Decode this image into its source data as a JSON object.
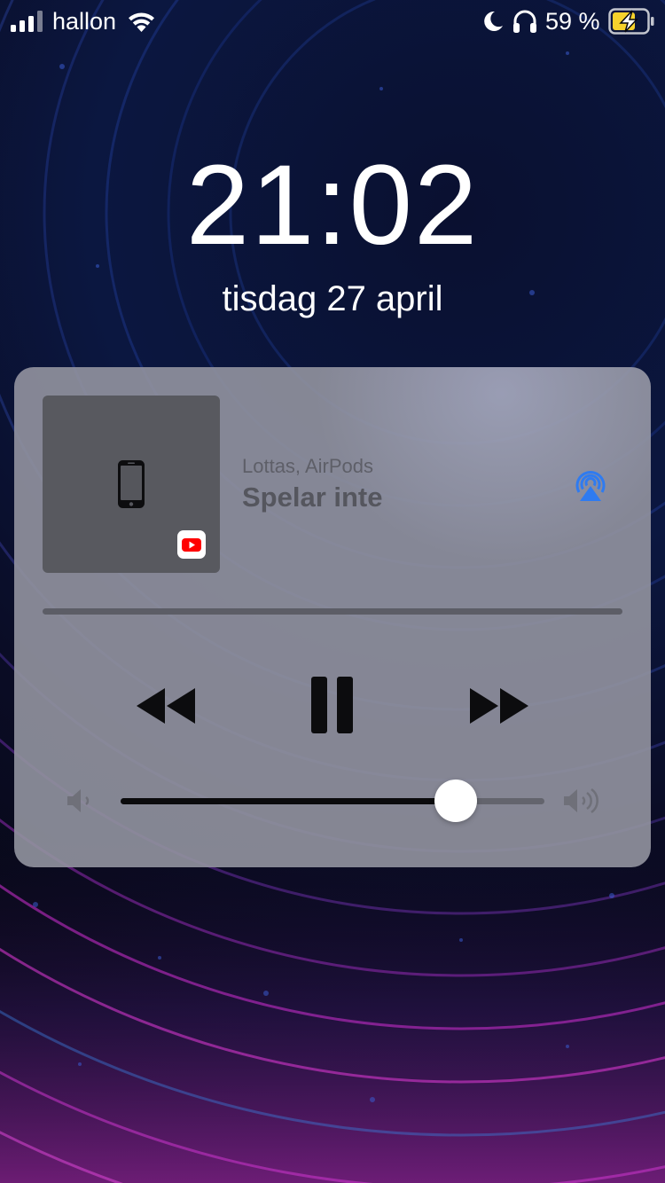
{
  "status_bar": {
    "carrier": "hallon",
    "battery_percent": "59 %",
    "icons": [
      "signal-icon",
      "wifi-icon",
      "moon-icon",
      "headphones-icon",
      "battery-charging-icon"
    ]
  },
  "lock_screen": {
    "time": "21:02",
    "date": "tisdag 27 april"
  },
  "now_playing": {
    "device_label": "Lottas, AirPods",
    "title": "Spelar inte",
    "progress": 0,
    "volume": 0.79,
    "icons": [
      "phone-icon",
      "youtube-icon",
      "airplay-icon",
      "rewind-icon",
      "pause-icon",
      "fast-forward-icon",
      "volume-low-icon",
      "volume-high-icon"
    ]
  },
  "colors": {
    "airplay": "#2f7bf0",
    "youtube": "#ff0000",
    "battery_charge": "#f6d22c",
    "card": "#9294a0"
  }
}
